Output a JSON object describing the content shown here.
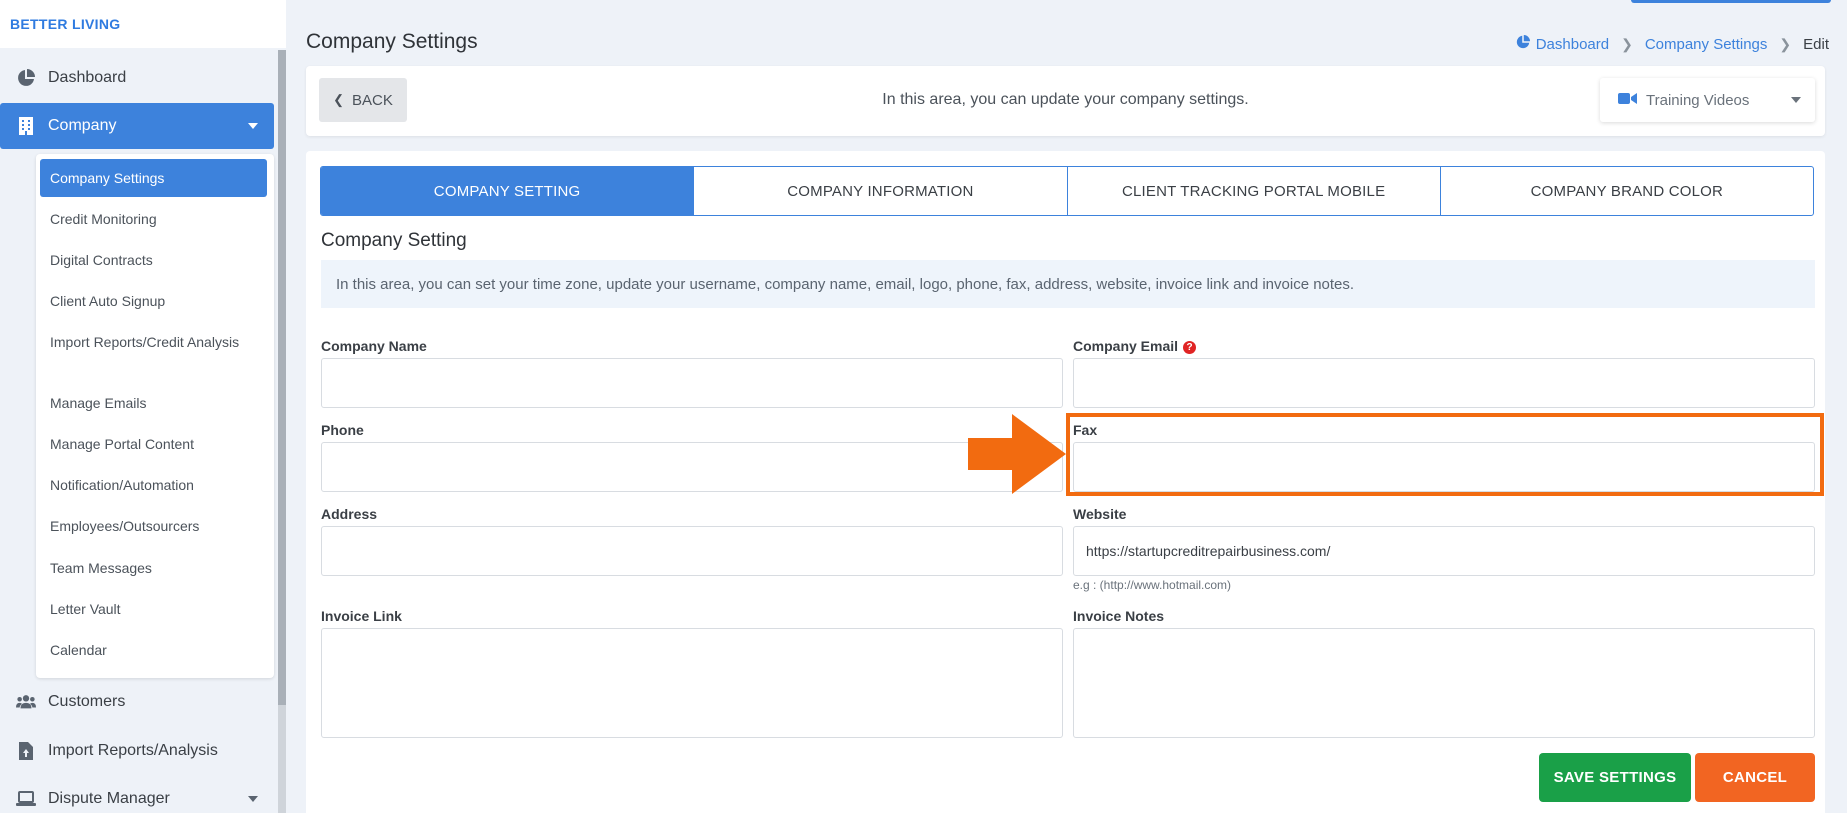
{
  "app": {
    "brand": "BETTER LIVING"
  },
  "sidebar": {
    "items": [
      {
        "label": "Dashboard",
        "icon": "pie-chart-icon"
      },
      {
        "label": "Company",
        "icon": "building-icon",
        "active": true
      },
      {
        "label": "Customers",
        "icon": "users-icon"
      },
      {
        "label": "Import Reports/Analysis",
        "icon": "file-upload-icon"
      },
      {
        "label": "Dispute Manager",
        "icon": "laptop-icon"
      }
    ],
    "submenu": [
      {
        "label": "Company Settings",
        "active": true
      },
      {
        "label": "Credit Monitoring"
      },
      {
        "label": "Digital Contracts"
      },
      {
        "label": "Client Auto Signup"
      },
      {
        "label": "Import Reports/Credit Analysis"
      },
      {
        "label": "Manage Emails"
      },
      {
        "label": "Manage Portal Content"
      },
      {
        "label": "Notification/Automation"
      },
      {
        "label": "Employees/Outsourcers"
      },
      {
        "label": "Team Messages"
      },
      {
        "label": "Letter Vault"
      },
      {
        "label": "Calendar"
      }
    ]
  },
  "header": {
    "title": "Company Settings",
    "breadcrumb": [
      "Dashboard",
      "Company Settings",
      "Edit"
    ]
  },
  "info_bar": {
    "back_label": "BACK",
    "text": "In this area, you can update your company settings.",
    "training_label": "Training Videos"
  },
  "tabs": [
    {
      "label": "COMPANY SETTING",
      "active": true
    },
    {
      "label": "COMPANY INFORMATION"
    },
    {
      "label": "CLIENT TRACKING PORTAL MOBILE"
    },
    {
      "label": "COMPANY BRAND COLOR"
    }
  ],
  "section": {
    "title": "Company Setting",
    "note": "In this area, you can set your time zone, update your username, company name, email, logo, phone, fax, address, website, invoice link and invoice notes."
  },
  "form": {
    "company_name": {
      "label": "Company Name",
      "value": ""
    },
    "company_email": {
      "label": "Company Email",
      "value": ""
    },
    "phone": {
      "label": "Phone",
      "value": ""
    },
    "fax": {
      "label": "Fax",
      "value": ""
    },
    "address": {
      "label": "Address",
      "value": ""
    },
    "website": {
      "label": "Website",
      "value": "https://startupcreditrepairbusiness.com/",
      "help": "e.g : (http://www.hotmail.com)"
    },
    "invoice_link": {
      "label": "Invoice Link",
      "value": ""
    },
    "invoice_notes": {
      "label": "Invoice Notes",
      "value": ""
    }
  },
  "actions": {
    "save_label": "SAVE SETTINGS",
    "cancel_label": "CANCEL"
  },
  "colors": {
    "accent": "#3d82dc",
    "save": "#1aa048",
    "cancel": "#f26522",
    "highlight": "#f26b10"
  }
}
